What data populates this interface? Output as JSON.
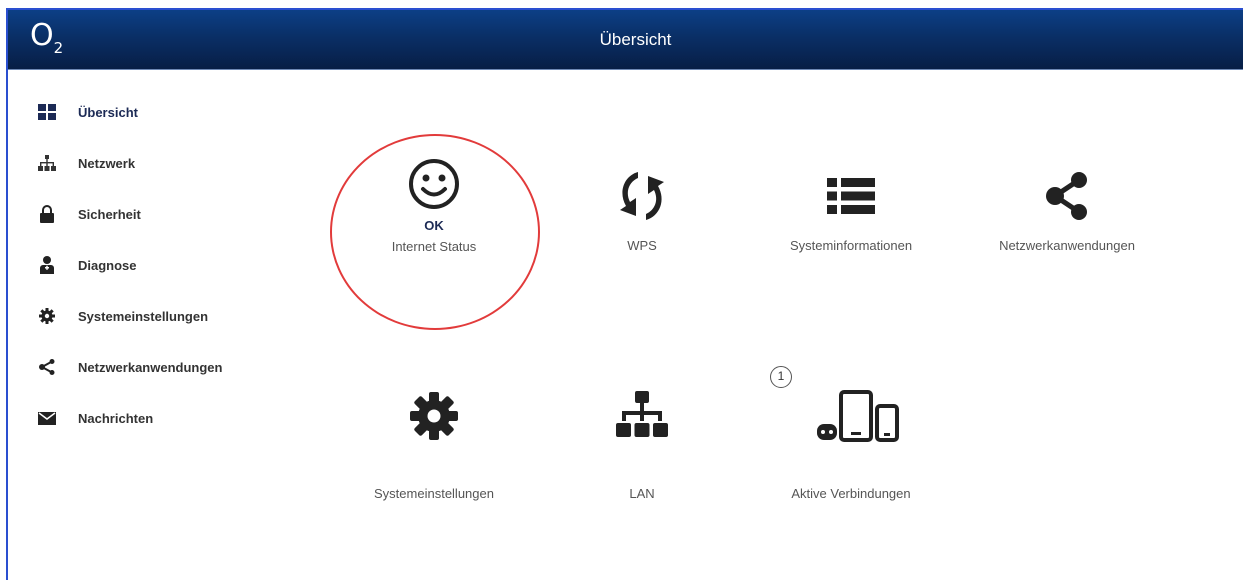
{
  "header": {
    "logo_main": "O",
    "logo_sub": "2",
    "title": "Übersicht"
  },
  "sidebar": {
    "items": [
      {
        "label": "Übersicht",
        "icon": "dashboard-icon"
      },
      {
        "label": "Netzwerk",
        "icon": "network-icon"
      },
      {
        "label": "Sicherheit",
        "icon": "lock-icon"
      },
      {
        "label": "Diagnose",
        "icon": "diagnose-icon"
      },
      {
        "label": "Systemeinstellungen",
        "icon": "gear-icon"
      },
      {
        "label": "Netzwerkanwendungen",
        "icon": "share-icon"
      },
      {
        "label": "Nachrichten",
        "icon": "envelope-icon"
      }
    ]
  },
  "tiles": {
    "internet_status": {
      "status": "OK",
      "label": "Internet Status",
      "icon": "smiley-icon"
    },
    "wps": {
      "label": "WPS",
      "icon": "wps-icon"
    },
    "systeminfo": {
      "label": "Systeminformationen",
      "icon": "list-icon"
    },
    "netapps": {
      "label": "Netzwerkanwendungen",
      "icon": "share-icon"
    },
    "settings": {
      "label": "Systemeinstellungen",
      "icon": "gear-icon"
    },
    "lan": {
      "label": "LAN",
      "icon": "network-icon"
    },
    "connections": {
      "label": "Aktive Verbindungen",
      "icon": "devices-icon",
      "badge": "1"
    }
  },
  "colors": {
    "header_top": "#0c3f86",
    "header_bottom": "#081e45",
    "highlight_ring": "#e23b3b",
    "icon_dark": "#333333"
  }
}
